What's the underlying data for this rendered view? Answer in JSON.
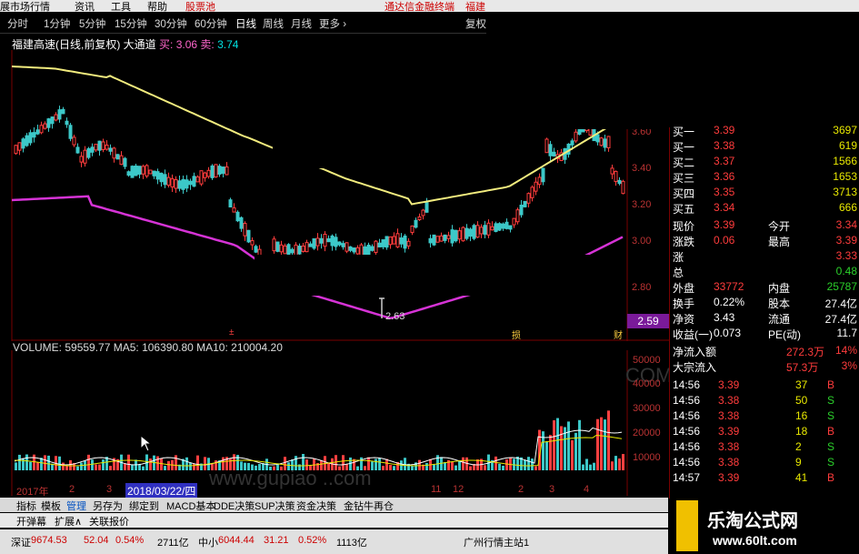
{
  "menubar": {
    "items": [
      "展市场行情",
      "资讯",
      "工具",
      "帮助",
      "股票池"
    ],
    "right_items": [
      "通达信金融终端",
      "福建"
    ]
  },
  "timeframes": {
    "items": [
      "分时",
      "1分钟",
      "5分钟",
      "15分钟",
      "30分钟",
      "60分钟",
      "日线",
      "周线",
      "月线",
      "更多 ›"
    ],
    "active": "日线",
    "right_label": "复权"
  },
  "chart_header": {
    "name": "福建高速(日线,前复权)",
    "indicator": "大通道",
    "buy_label": "买:",
    "buy_value": "3.06",
    "sell_label": "卖:",
    "sell_value": "3.74"
  },
  "price_axis": {
    "ticks": [
      "3.60",
      "3.40",
      "3.20",
      "3.00",
      "2.80"
    ],
    "current_price_box": "2.59"
  },
  "annotations": {
    "low_label": "2.63",
    "marker_1": "±",
    "marker_2": "损",
    "marker_3": "财"
  },
  "volume_header": {
    "text": "VOLUME: 59559.77  MA5: 106390.80  MA10: 210004.20"
  },
  "volume_axis": {
    "ticks": [
      "50000",
      "40000",
      "30000",
      "20000",
      "10000"
    ]
  },
  "date_axis": {
    "year_label": "2017年",
    "months": [
      "2",
      "3",
      "11",
      "12",
      "2",
      "3",
      "4"
    ],
    "cursor_date": "2018/03/22/四"
  },
  "watermarks": {
    "line1": "COM",
    "line2": "www.gupiao ..com"
  },
  "order_book": {
    "rows": [
      {
        "label": "买一",
        "price": "3.39",
        "vol": "3697"
      },
      {
        "label": "买一",
        "price": "3.38",
        "vol": "619"
      },
      {
        "label": "买二",
        "price": "3.37",
        "vol": "1566"
      },
      {
        "label": "买三",
        "price": "3.36",
        "vol": "1653"
      },
      {
        "label": "买四",
        "price": "3.35",
        "vol": "3713"
      },
      {
        "label": "买五",
        "price": "3.34",
        "vol": "666"
      }
    ]
  },
  "quote": {
    "rows": [
      {
        "l1": "现价",
        "v1": "3.39",
        "l2": "今开",
        "v2": "3.34"
      },
      {
        "l1": "涨跌",
        "v1": "0.06",
        "l2": "最高",
        "v2": "3.39"
      },
      {
        "l1": "涨",
        "v1": "",
        "l2": "",
        "v2": "3.33"
      },
      {
        "l1": "总",
        "v1": "",
        "l2": "",
        "v2": "0.48"
      },
      {
        "l1": "外盘",
        "v1": "33772",
        "l2": "内盘",
        "v2": "25787"
      },
      {
        "l1": "换手",
        "v1": "0.22%",
        "l2": "股本",
        "v2": "27.4亿"
      },
      {
        "l1": "净资",
        "v1": "3.43",
        "l2": "流通",
        "v2": "27.4亿"
      },
      {
        "l1": "收益(一)",
        "v1": "0.073",
        "l2": "PE(动)",
        "v2": "11.7"
      }
    ]
  },
  "flows": [
    {
      "label": "净流入额",
      "value": "272.3万",
      "pct": "14%"
    },
    {
      "label": "大宗流入",
      "value": "57.3万",
      "pct": "3%"
    }
  ],
  "ticks_list": [
    {
      "time": "14:56",
      "price": "3.39",
      "vol": "37",
      "dir": "B"
    },
    {
      "time": "14:56",
      "price": "3.38",
      "vol": "50",
      "dir": "S"
    },
    {
      "time": "14:56",
      "price": "3.38",
      "vol": "16",
      "dir": "S"
    },
    {
      "time": "14:56",
      "price": "3.39",
      "vol": "18",
      "dir": "B"
    },
    {
      "time": "14:56",
      "price": "3.38",
      "vol": "2",
      "dir": "S"
    },
    {
      "time": "14:56",
      "price": "3.38",
      "vol": "9",
      "dir": "S"
    },
    {
      "time": "14:57",
      "price": "3.39",
      "vol": "41",
      "dir": "B"
    }
  ],
  "tabs": {
    "items": [
      "指标",
      "模板",
      "管理",
      "另存为",
      "绑定到",
      "MACD基本",
      "DDE决策",
      "SUP决策",
      "资金决策",
      "金钻牛再仓"
    ]
  },
  "subtabs": {
    "items": [
      "开弹幕",
      "扩展∧",
      "关联报价"
    ]
  },
  "status": {
    "sh_label": "深证",
    "sh_value": "9674.53",
    "sh_change": "52.04",
    "sh_pct": "0.54%",
    "sh_amount": "2711亿",
    "zx_label": "中小",
    "zx_value": "6044.44",
    "zx_change": "31.21",
    "zx_pct": "0.52%",
    "zx_amount": "1113亿",
    "right_text": "广州行情主站1"
  },
  "logo": {
    "cn": "乐淘公式网",
    "url": "www.60lt.com"
  },
  "colors": {
    "bg": "#000000",
    "up": "#ff3c3c",
    "down": "#2bd02b",
    "ma_upper": "#f2ec7e",
    "ma_lower": "#d633d6",
    "volume_up": "#ff4040",
    "volume_down": "#3cc8c8"
  }
}
